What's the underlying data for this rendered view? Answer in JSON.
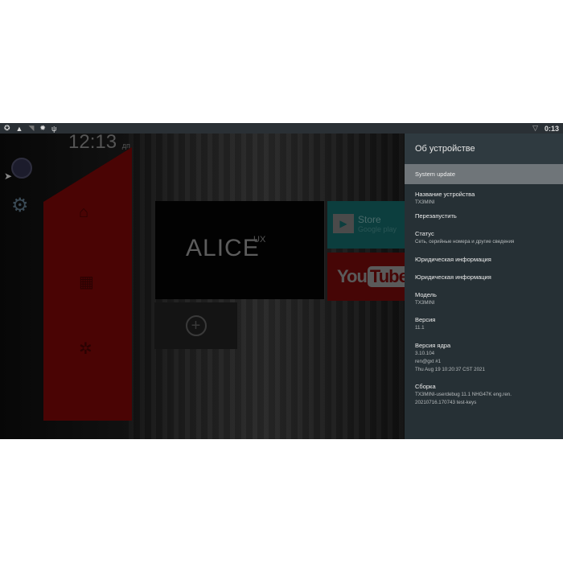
{
  "statusbar": {
    "icons": [
      "settings-cog-icon",
      "warning-icon",
      "wifi-weak-icon",
      "gear-icon",
      "usb-icon"
    ],
    "wifi": "wifi-icon",
    "time": "0:13"
  },
  "launcher": {
    "clock": "12:13",
    "ampm": "дп",
    "alice_title": "ALICE",
    "alice_sup": "UX",
    "store_title": "Store",
    "store_sub": "Google play",
    "youtube_you": "You",
    "youtube_tube": "Tube",
    "add_symbol": "+"
  },
  "panel": {
    "title": "Об устройстве",
    "items": [
      {
        "title": "System update",
        "sub": []
      },
      {
        "title": "Название устройства",
        "sub": [
          "TX3MINI"
        ]
      },
      {
        "title": "Перезапустить",
        "sub": []
      },
      {
        "title": "Статус",
        "sub": [
          "Сеть, серийные номера и другие сведения"
        ]
      },
      {
        "title": "Юридическая информация",
        "sub": []
      },
      {
        "title": "Юридическая информация",
        "sub": []
      },
      {
        "title": "Модель",
        "sub": [
          "TX3MINI"
        ]
      },
      {
        "title": "Версия",
        "sub": [
          "11.1"
        ]
      },
      {
        "title": "Версия ядра",
        "sub": [
          "3.10.104",
          "ren@gxt #1",
          "Thu Aug 19 10:20:37 CST 2021"
        ]
      },
      {
        "title": "Сборка",
        "sub": [
          "TX3MINI-userdebug 11.1 NHG47K eng.ren.",
          "20210716.170743 test-keys"
        ]
      }
    ]
  }
}
